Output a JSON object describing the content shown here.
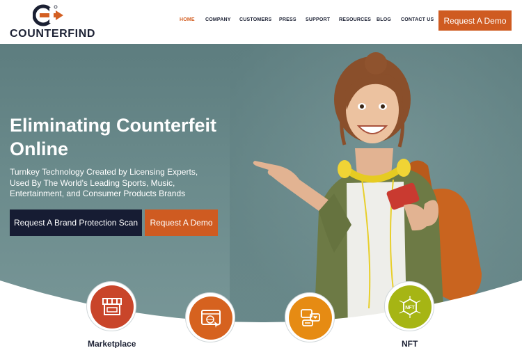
{
  "brand": {
    "name": "COUNTERFIND"
  },
  "nav": {
    "items": [
      "HOME",
      "COMPANY",
      "CUSTOMERS",
      "PRESS",
      "SUPPORT",
      "RESOURCES",
      "BLOG",
      "CONTACT US"
    ],
    "active": "HOME",
    "cta": "Request A Demo"
  },
  "hero": {
    "title_line1": "Eliminating Counterfeit",
    "title_line2": "Online",
    "subtitle_line1": "Turnkey Technology Created by Licensing Experts,",
    "subtitle_line2": "Used By The World's Leading Sports, Music,",
    "subtitle_line3": "Entertainment, and Consumer Products Brands",
    "primary_button": "Request A Brand Protection Scan",
    "secondary_button": "Request A Demo"
  },
  "features": [
    {
      "label": "Marketplace",
      "icon": "storefront-icon",
      "color": "#c9452a"
    },
    {
      "label": "",
      "icon": "website-icon",
      "color": "#d6621f"
    },
    {
      "label": "",
      "icon": "social-media-icon",
      "color": "#e68b13"
    },
    {
      "label": "NFT",
      "icon": "nft-icon",
      "color": "#a6b514"
    }
  ],
  "colors": {
    "accent": "#cf5b21",
    "navy": "#161c33",
    "active_nav": "#d35f22"
  }
}
